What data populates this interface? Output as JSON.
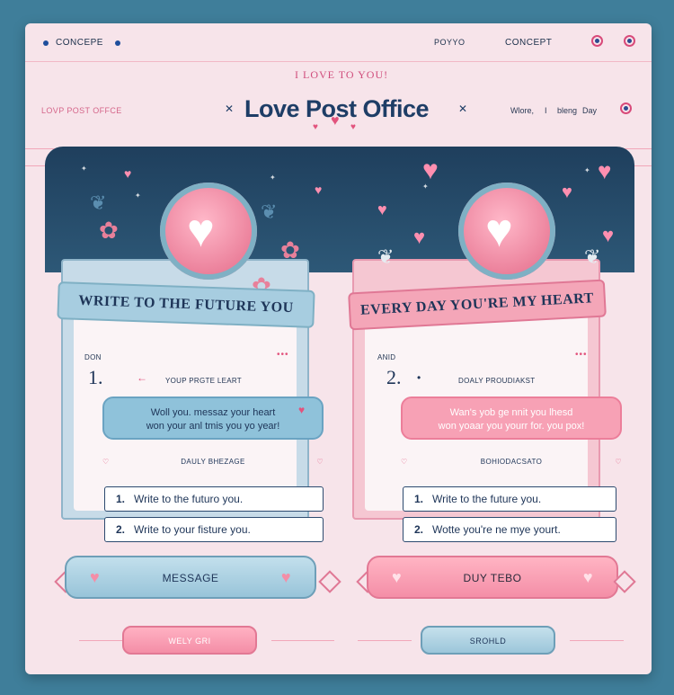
{
  "topbar": {
    "left_label": "CONCEPE",
    "mid_label": "POYYO",
    "right_label": "CONCEPT"
  },
  "header": {
    "arc_text": "I LOVE TO YOU!",
    "logo": "Love Post Office",
    "left_text": "LOVP POST OFFCE",
    "right_items": [
      "Wlore,",
      "I",
      "bleng",
      "Day"
    ]
  },
  "panels": [
    {
      "ribbon": "WRITE TO THE FUTURE YOU",
      "small_label": "DON",
      "number": "1.",
      "title_line": "YOUP PRGTE LEART",
      "message_lines": [
        "Woll you. messaz your heart",
        "won your anl tmis you yo year!"
      ],
      "sub_label": "DAULY BHEZAGE",
      "items": [
        {
          "num": "1.",
          "text": "Write to the futuro you."
        },
        {
          "num": "2.",
          "text": "Write to your fisture you."
        }
      ]
    },
    {
      "ribbon": "EVERY DAY YOU'RE MY HEART",
      "small_label": "ANID",
      "number": "2.",
      "title_line": "DOALY PROUDIAKST",
      "message_lines": [
        "Wan's yob ge nnit you lhesd",
        "won yoaar you yourr for. you pox!"
      ],
      "sub_label": "BOHIODACSATO",
      "items": [
        {
          "num": "1.",
          "text": "Write to the future you."
        },
        {
          "num": "2.",
          "text": "Wotte you're ne mye yourt."
        }
      ]
    }
  ],
  "buttons": {
    "message": "MESSAGE",
    "duy": "DUY TEBO",
    "small_left": "WELY GRI",
    "small_right": "SROHLD"
  },
  "colors": {
    "blue": "#8fc2da",
    "pink": "#f48ea7",
    "navy": "#1e3d66",
    "accent": "#d84a7a"
  }
}
